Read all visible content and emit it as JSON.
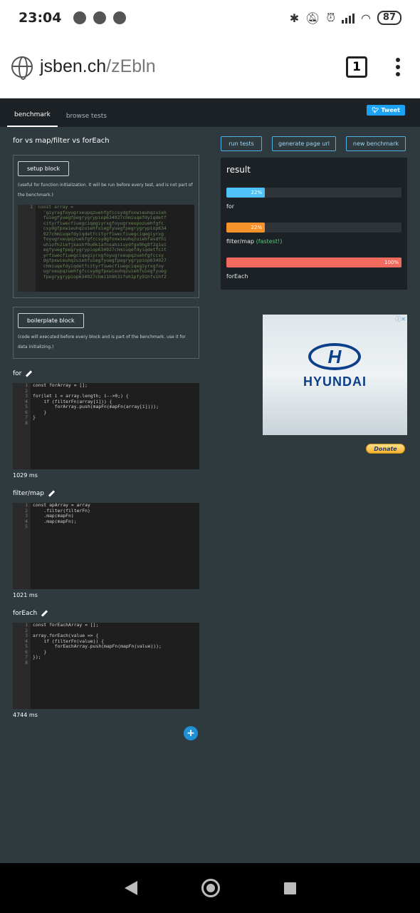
{
  "status": {
    "time": "23:04",
    "battery": "87"
  },
  "browser": {
    "url_host": "jsben.ch",
    "url_path": "/zEbln",
    "tab_count": "1"
  },
  "nav": {
    "tabs": [
      "benchmark",
      "browse tests"
    ],
    "tweet": "Tweet"
  },
  "page_title": "for vs map/filter vs forEach",
  "setup": {
    "button": "setup block",
    "hint": "(useful for function initialization. it will be run before every test, and is not part of the benchmark.)",
    "line_numbers": "1",
    "code": "const array =\n  'giyrxgfoyugrxeupqzuehfgfccsydgfoxwieuhqzuieh\n  fuiegfyuegfpegrygrypiop634927chmiuqefdyiqdetf\n  cityrfiwecfiuegciqegiyrxgfoyugrxeupozuehfgfc\n  csydgfpxwieuhqzuiehfuiegfyuegfpegrygrypiop634\n  927chmiuqefdyiqdetfcityrfiwecfiuegciqegiyrxg\n  foyugrxeupqzuehfgfccsydgfoxwieuhqzuiehfasdfhi\n  uhiofh2iefjkashf0u0k1afnsahsiuydfgo9hg8f2giui\n  egfyuegfpegrygrypiop634927chmiuqefdyiqdetfcit\n  yrfiwecfiuegciqegiyrxgfoyugrxeupqzuehfgfccsy\n  dgfpxwieuhqzuiehfuiegfyuegfpegrygrypiop634927\n  chmiuqefdyiqdetfcityrfiwecfiuegciqegiyrxgfoy\n  ugrxeupqzuehfgfccsydgfpxwieuhqzuiehfuiegfyueg\n  fpegrygrypiop634927chmi1h9h3ifoh1pfy91hfuihf2"
  },
  "boilerplate": {
    "button": "boilerplate block",
    "hint": "(code will executed before every block and is part of the benchmark. use it for data initializing.)"
  },
  "tests": [
    {
      "label": "for",
      "line_numbers": "1\n2\n3\n4\n5\n6\n7\n8",
      "code": "const forArray = [];\n\nfor(let i = array.length; i-->0;) {\n    if (filterFn(array[i])) {\n        forArray.push(mapFn(mapFn(array[i])));\n    }\n}\n",
      "timing": "1029 ms"
    },
    {
      "label": "filter/map",
      "line_numbers": "1\n2\n3\n4\n5",
      "code": "const apArray = array\n    .filter(filterFn)\n    .map(mapFn)\n    .map(mapFn);\n",
      "timing": "1021 ms"
    },
    {
      "label": "forEach",
      "line_numbers": "1\n2\n3\n4\n5\n6\n7\n8",
      "code": "const forEachArray = [];\n\narray.forEach(value => {\n    if (filterFn(value)) {\n        forEachArray.push(mapFn(mapFn(value)));\n    }\n});\n",
      "timing": "4744 ms"
    }
  ],
  "add_button": "+",
  "actions": [
    "run tests",
    "generate page url",
    "new benchmark"
  ],
  "result": {
    "title": "result",
    "bars": [
      {
        "name": "for",
        "percent_label": "22%",
        "fraction": 0.22,
        "color": "#4fc3f7",
        "note": ""
      },
      {
        "name": "filter/map",
        "percent_label": "22%",
        "fraction": 0.22,
        "color": "#f7922a",
        "note": "(fastest!)"
      },
      {
        "name": "forEach",
        "percent_label": "100%",
        "fraction": 1.0,
        "color": "#f06a5e",
        "note": ""
      }
    ]
  },
  "ad": {
    "brand": "HYUNDAI",
    "logo_letter": "H"
  },
  "donate": "Donate"
}
